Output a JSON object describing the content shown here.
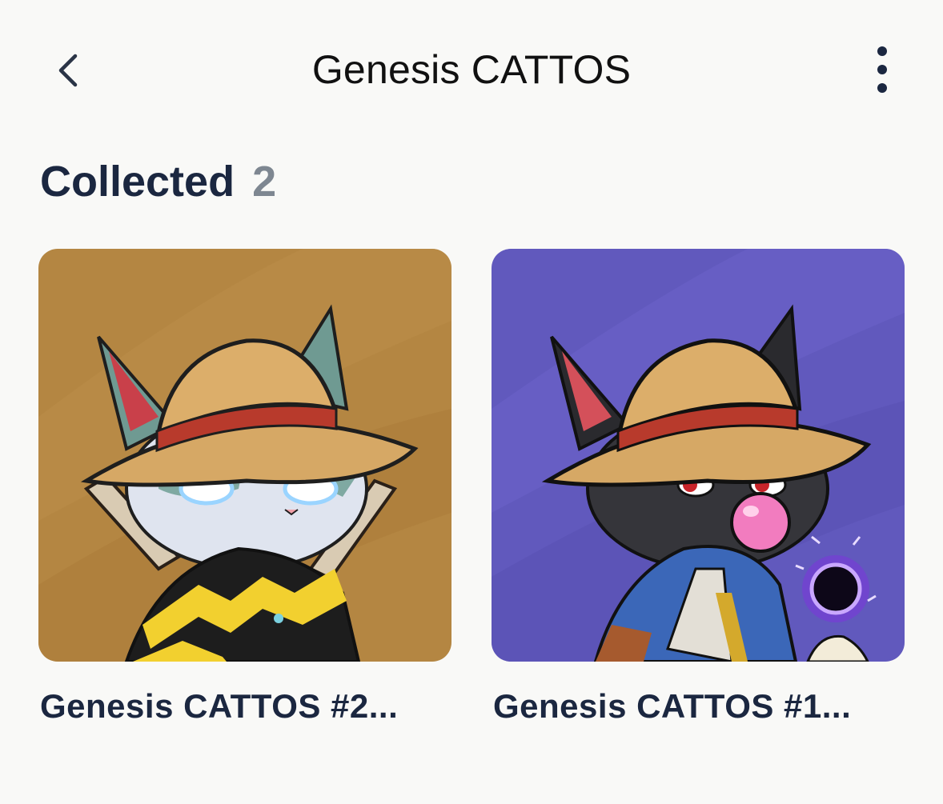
{
  "header": {
    "title": "Genesis CATTOS",
    "back_icon": "chevron-left-icon",
    "more_icon": "more-vertical-icon"
  },
  "section": {
    "title": "Collected",
    "count": "2"
  },
  "items": [
    {
      "name": "Genesis CATTOS #2...",
      "background": "#b48642"
    },
    {
      "name": "Genesis CATTOS #1...",
      "background": "#6159bd"
    }
  ]
}
